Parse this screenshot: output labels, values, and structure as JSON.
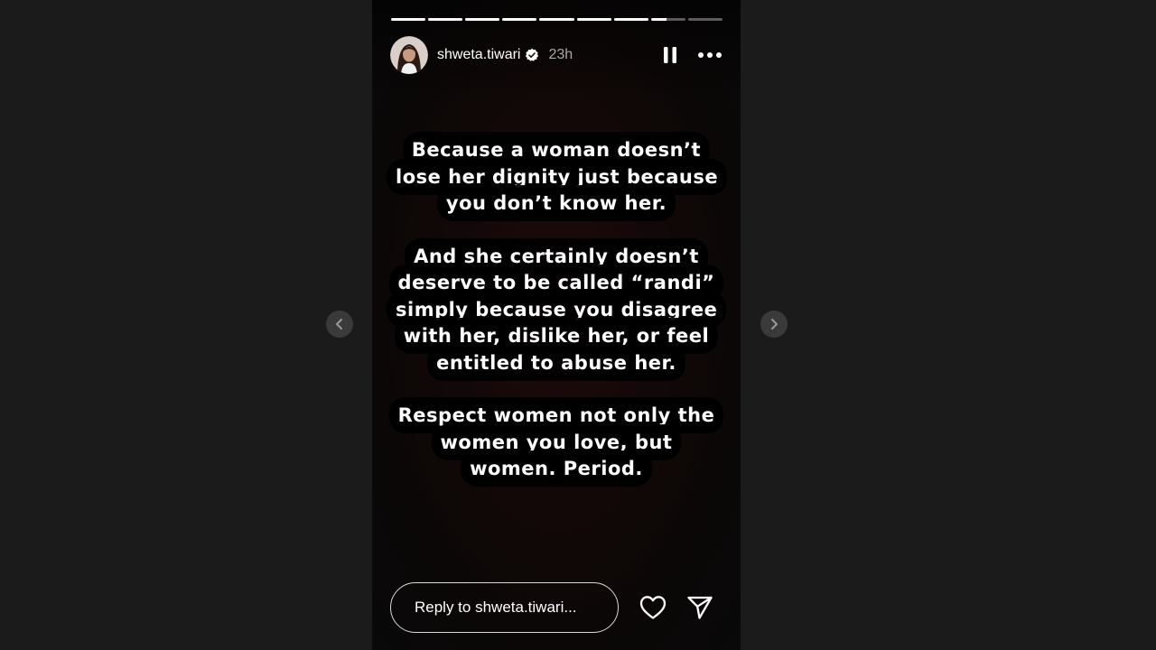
{
  "story": {
    "username": "shweta.tiwari",
    "time_ago": "23h",
    "verified": true,
    "progress": {
      "segments": 9,
      "completed_segments": 7,
      "current_segment_progress": 0.45
    },
    "paragraphs": [
      "Because a woman doesn’t lose her dignity just because you don’t know her.",
      "And she certainly doesn’t deserve to be called “randi” simply because you disagree with her, dislike her, or feel entitled to abuse her.",
      "Respect women not only the women you love, but women. Period."
    ]
  },
  "reply": {
    "placeholder": "Reply to shweta.tiwari..."
  },
  "icons": {
    "pause": "pause-icon",
    "more": "more-horizontal-icon",
    "like": "heart-icon",
    "share": "send-icon",
    "prev": "chevron-left-icon",
    "next": "chevron-right-icon",
    "verified": "verified-badge-icon"
  },
  "colors": {
    "page_background": "#1b1b1b",
    "story_background": "#120807",
    "text": "#ffffff",
    "muted_text": "#a8a8a8",
    "verified_badge": "#ffffff"
  }
}
